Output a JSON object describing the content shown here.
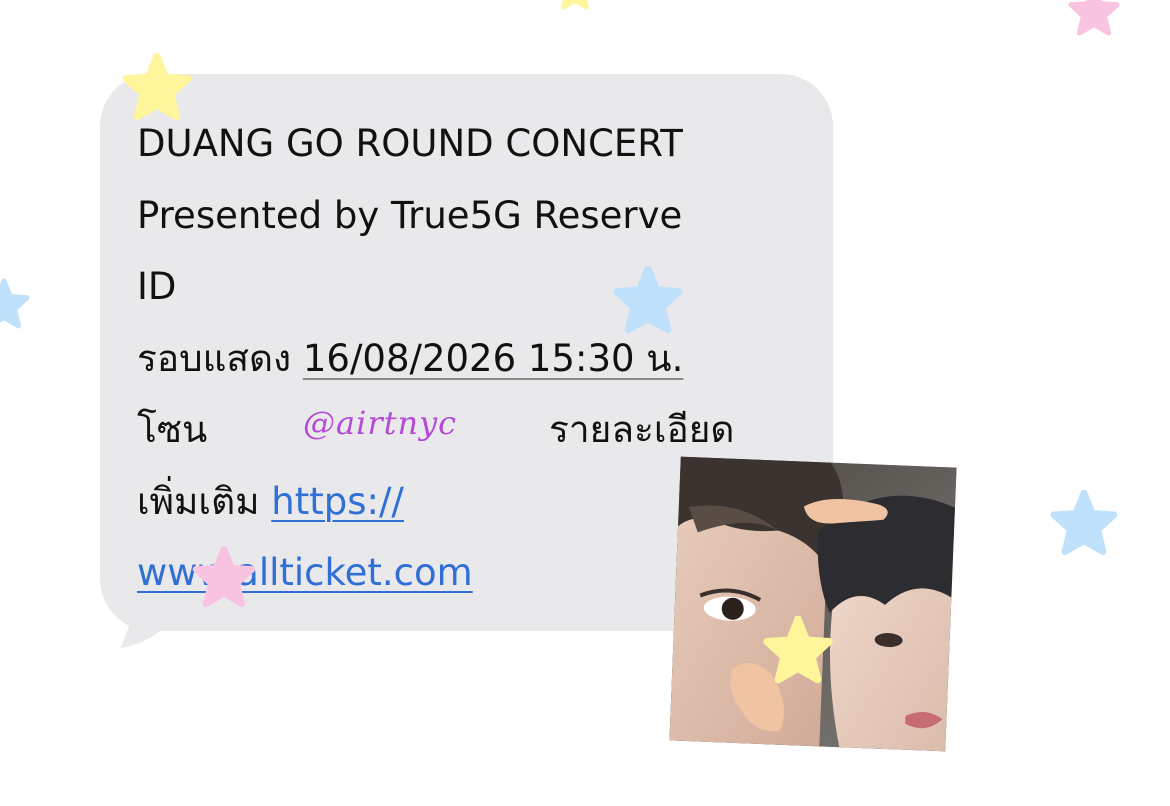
{
  "message": {
    "line1": "DUANG GO ROUND CONCERT",
    "line2": "Presented by True5G Reserve",
    "line3": "ID",
    "showtime_label": "รอบแสดง",
    "showtime_value": "16/08/2026 15:30 น.",
    "zone_label": "โซน",
    "detail_label": "รายละเอียด",
    "more_label": "เพิ่มเติม",
    "url_part1": "https://",
    "url_part2": "www.allticket.com"
  },
  "watermark": {
    "handle": "@airtnyc"
  },
  "icons": {
    "stars": [
      "yellow-star-icon",
      "pink-star-icon",
      "blue-star-icon"
    ],
    "hands": [
      "hand-icon"
    ]
  },
  "colors": {
    "bubble": "#e9e9eb",
    "link": "#2f6fd6",
    "handle": "#b44ad6",
    "star_yellow": "#fff59a",
    "star_pink": "#f9c4e2",
    "star_blue": "#bfe1fb"
  }
}
